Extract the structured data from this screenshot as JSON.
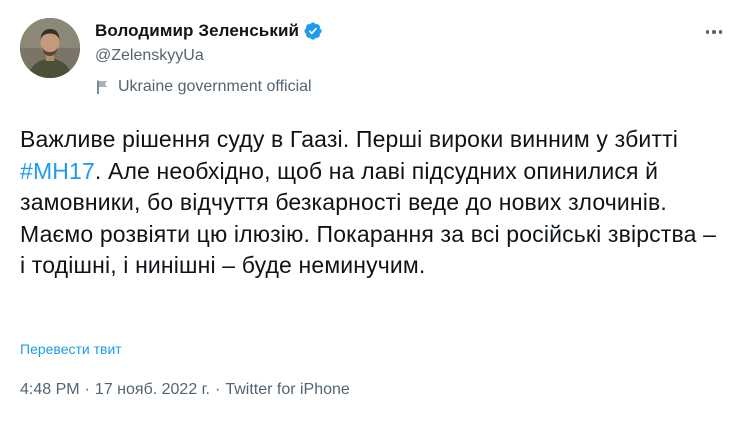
{
  "author": {
    "display_name": "Володимир Зеленський",
    "handle": "@ZelenskyyUa",
    "label": "Ukraine government official",
    "label_icon": "flag-icon",
    "verified_icon": "verified-badge-icon",
    "avatar_icon": "avatar"
  },
  "more_icon": "more-options-icon",
  "tweet": {
    "text_before": "Важливе рішення суду в Гаазі. Перші вироки винним у збитті ",
    "hashtag": "#MH17",
    "text_after": ". Але необхідно, щоб на лаві підсудних опинилися й замовники, бо відчуття безкарності веде до нових злочинів. Маємо розвіяти цю ілюзію. Покарання за всі російські звірства – і тодішні, і нинішні – буде неминучим."
  },
  "translate_label": "Перевести твит",
  "meta": {
    "time": "4:48 PM",
    "separator": "·",
    "date": "17 нояб. 2022 г.",
    "source": "Twitter for iPhone"
  },
  "colors": {
    "accent": "#1d9bf0",
    "text": "#0f1419",
    "secondary": "#536471"
  }
}
